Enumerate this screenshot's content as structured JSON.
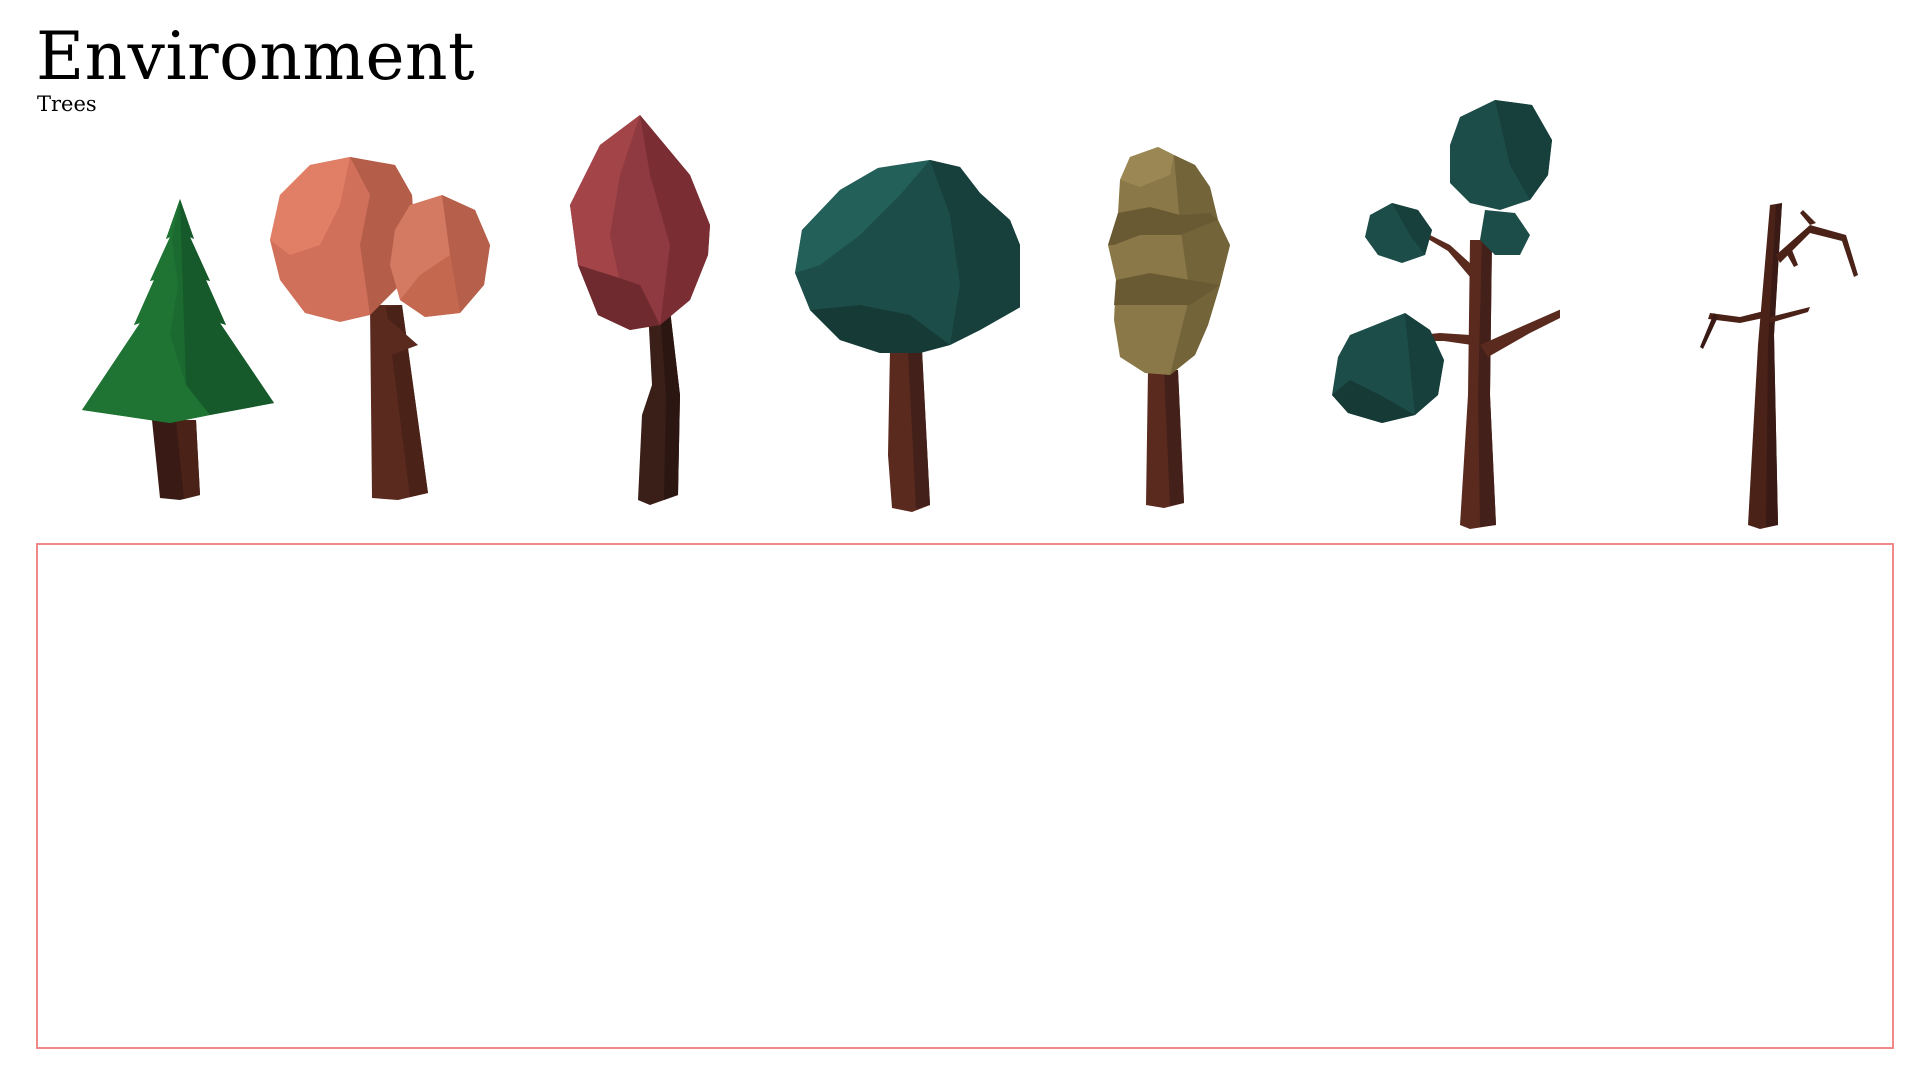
{
  "header": {
    "title": "Environment",
    "subtitle": "Trees"
  },
  "colors": {
    "frame_border": "#f08a8a",
    "pine_foliage": "#1b6a30",
    "salmon_foliage": "#d0705a",
    "maroon_foliage": "#8e3a40",
    "teal_foliage": "#1d4d48",
    "olive_foliage": "#8a7848",
    "trunk": "#5a2a1e"
  },
  "trees": [
    {
      "name": "pine-tree",
      "style": "conifer"
    },
    {
      "name": "salmon-double-tree",
      "style": "two round crowns"
    },
    {
      "name": "maroon-tall-tree",
      "style": "tall pointed crown"
    },
    {
      "name": "teal-round-tree",
      "style": "round crown"
    },
    {
      "name": "olive-stacked-tree",
      "style": "stacked crown"
    },
    {
      "name": "teal-branching-tree",
      "style": "branching with clusters"
    },
    {
      "name": "bare-dead-tree",
      "style": "leafless"
    }
  ]
}
